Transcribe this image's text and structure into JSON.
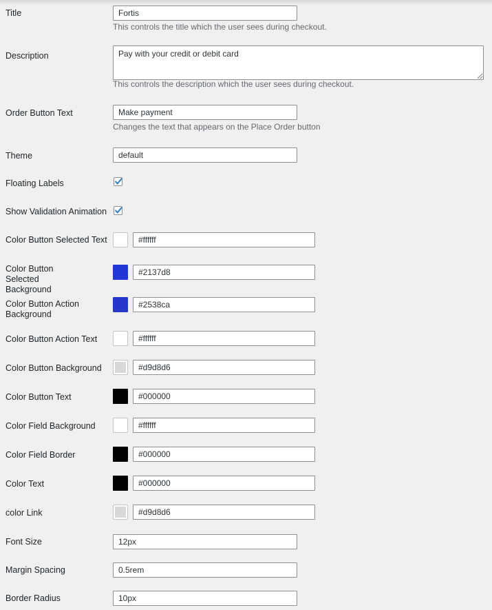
{
  "form": {
    "rows": [
      {
        "key": "title",
        "label": "Title",
        "type": "text",
        "value": "Fortis",
        "help": "This controls the title which the user sees during checkout."
      },
      {
        "key": "description",
        "label": "Description",
        "type": "textarea",
        "value": "Pay with your credit or debit card",
        "help": "This controls the description which the user sees during checkout."
      },
      {
        "key": "order_button_text",
        "label": "Order Button Text",
        "type": "text",
        "value": "Make payment",
        "help": "Changes the text that appears on the Place Order button"
      },
      {
        "key": "theme",
        "label": "Theme",
        "type": "text",
        "value": "default",
        "help": ""
      },
      {
        "key": "floating_labels",
        "label": "Floating Labels",
        "type": "checkbox",
        "checked": true,
        "help": ""
      },
      {
        "key": "show_validation_animation",
        "label": "Show Validation Animation",
        "type": "checkbox",
        "checked": true,
        "help": ""
      },
      {
        "key": "color_button_selected_text",
        "label": "Color Button Selected Text",
        "type": "color",
        "value": "#ffffff",
        "swatch": "#ffffff",
        "help": ""
      },
      {
        "key": "color_button_selected_background",
        "label": "Color Button Selected Background",
        "type": "color",
        "value": "#2137d8",
        "swatch": "#2137d8",
        "help": ""
      },
      {
        "key": "color_button_action_background",
        "label": "Color Button Action Background",
        "type": "color",
        "value": "#2538ca",
        "swatch": "#2538ca",
        "help": ""
      },
      {
        "key": "color_button_action_text",
        "label": "Color Button Action Text",
        "type": "color",
        "value": "#ffffff",
        "swatch": "#ffffff",
        "help": ""
      },
      {
        "key": "color_button_background",
        "label": "Color Button Background",
        "type": "color",
        "value": "#d9d8d6",
        "swatch": "#d9d8d6",
        "help": ""
      },
      {
        "key": "color_button_text",
        "label": "Color Button Text",
        "type": "color",
        "value": "#000000",
        "swatch": "#000000",
        "help": ""
      },
      {
        "key": "color_field_background",
        "label": "Color Field Background",
        "type": "color",
        "value": "#ffffff",
        "swatch": "#ffffff",
        "help": ""
      },
      {
        "key": "color_field_border",
        "label": "Color Field Border",
        "type": "color",
        "value": "#000000",
        "swatch": "#000000",
        "help": ""
      },
      {
        "key": "color_text",
        "label": "Color Text",
        "type": "color",
        "value": "#000000",
        "swatch": "#000000",
        "help": ""
      },
      {
        "key": "color_link",
        "label": "color Link",
        "type": "color",
        "value": "#d9d8d6",
        "swatch": "#d9d8d6",
        "help": ""
      },
      {
        "key": "font_size",
        "label": "Font Size",
        "type": "text",
        "value": "12px",
        "help": ""
      },
      {
        "key": "margin_spacing",
        "label": "Margin Spacing",
        "type": "text",
        "value": "0.5rem",
        "help": ""
      },
      {
        "key": "border_radius",
        "label": "Border Radius",
        "type": "text",
        "value": "10px",
        "help": ""
      }
    ]
  },
  "theme_colors": {
    "page_background": "#f0f0f1",
    "field_border": "#8c8f94",
    "label_text": "#1d2327",
    "help_text": "#646970",
    "checkbox_check": "#3582c4"
  }
}
